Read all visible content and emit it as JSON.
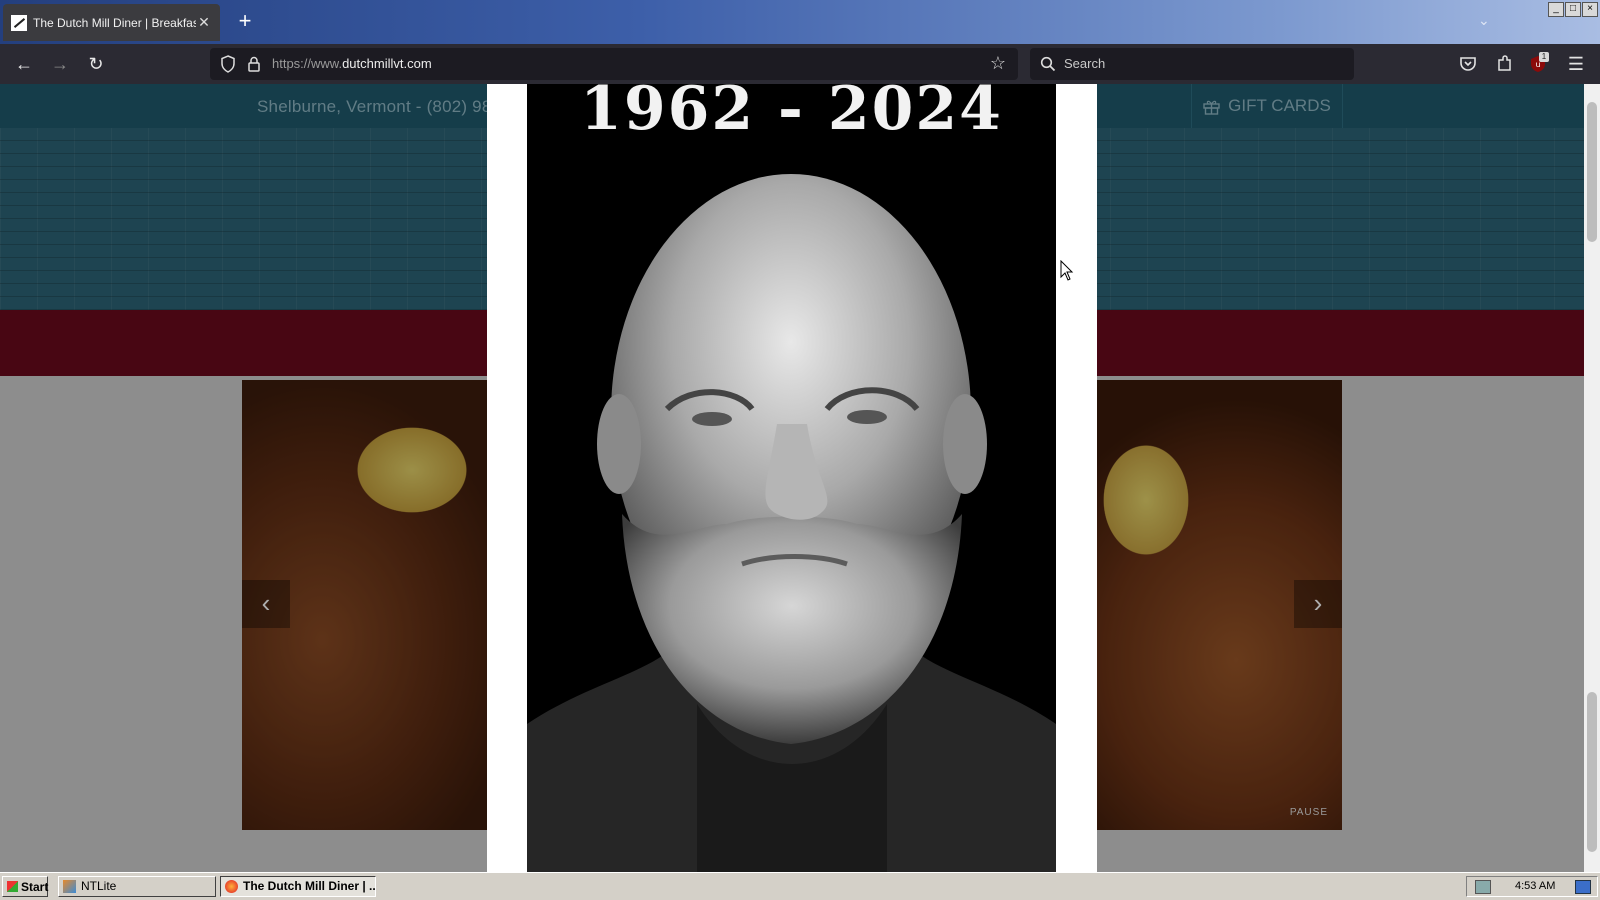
{
  "browser": {
    "tab_title": "The Dutch Mill Diner | Breakfast & L",
    "tab_close": "✕",
    "new_tab": "+",
    "url_prefix": "https://www.",
    "url_domain": "dutchmillvt.com",
    "search_placeholder": "Search",
    "extension_badge": "1"
  },
  "site": {
    "header_contact": "Shelburne, Vermont - (802) 98",
    "gift_cards_label": "GIFT CARDS",
    "slider_prev": "‹",
    "slider_next": "›",
    "slider_pause": "PAUSE"
  },
  "modal": {
    "years_text": "1962 - 2024"
  },
  "taskbar": {
    "start_label": "Start",
    "tasks": [
      {
        "label": "NTLite"
      },
      {
        "label": "The Dutch Mill Diner | ..."
      }
    ],
    "clock": "4:53 AM"
  },
  "colors": {
    "header_teal": "#1f5a6d",
    "siding_teal": "#2d6578",
    "brand_red": "#6b0a1d",
    "browser_dark": "#2b2a33"
  },
  "icons": [
    "back-icon",
    "forward-icon",
    "reload-icon",
    "shield-icon",
    "lock-icon",
    "star-icon",
    "search-icon",
    "pocket-icon",
    "extensions-icon",
    "ublock-icon",
    "menu-icon",
    "gift-icon"
  ]
}
